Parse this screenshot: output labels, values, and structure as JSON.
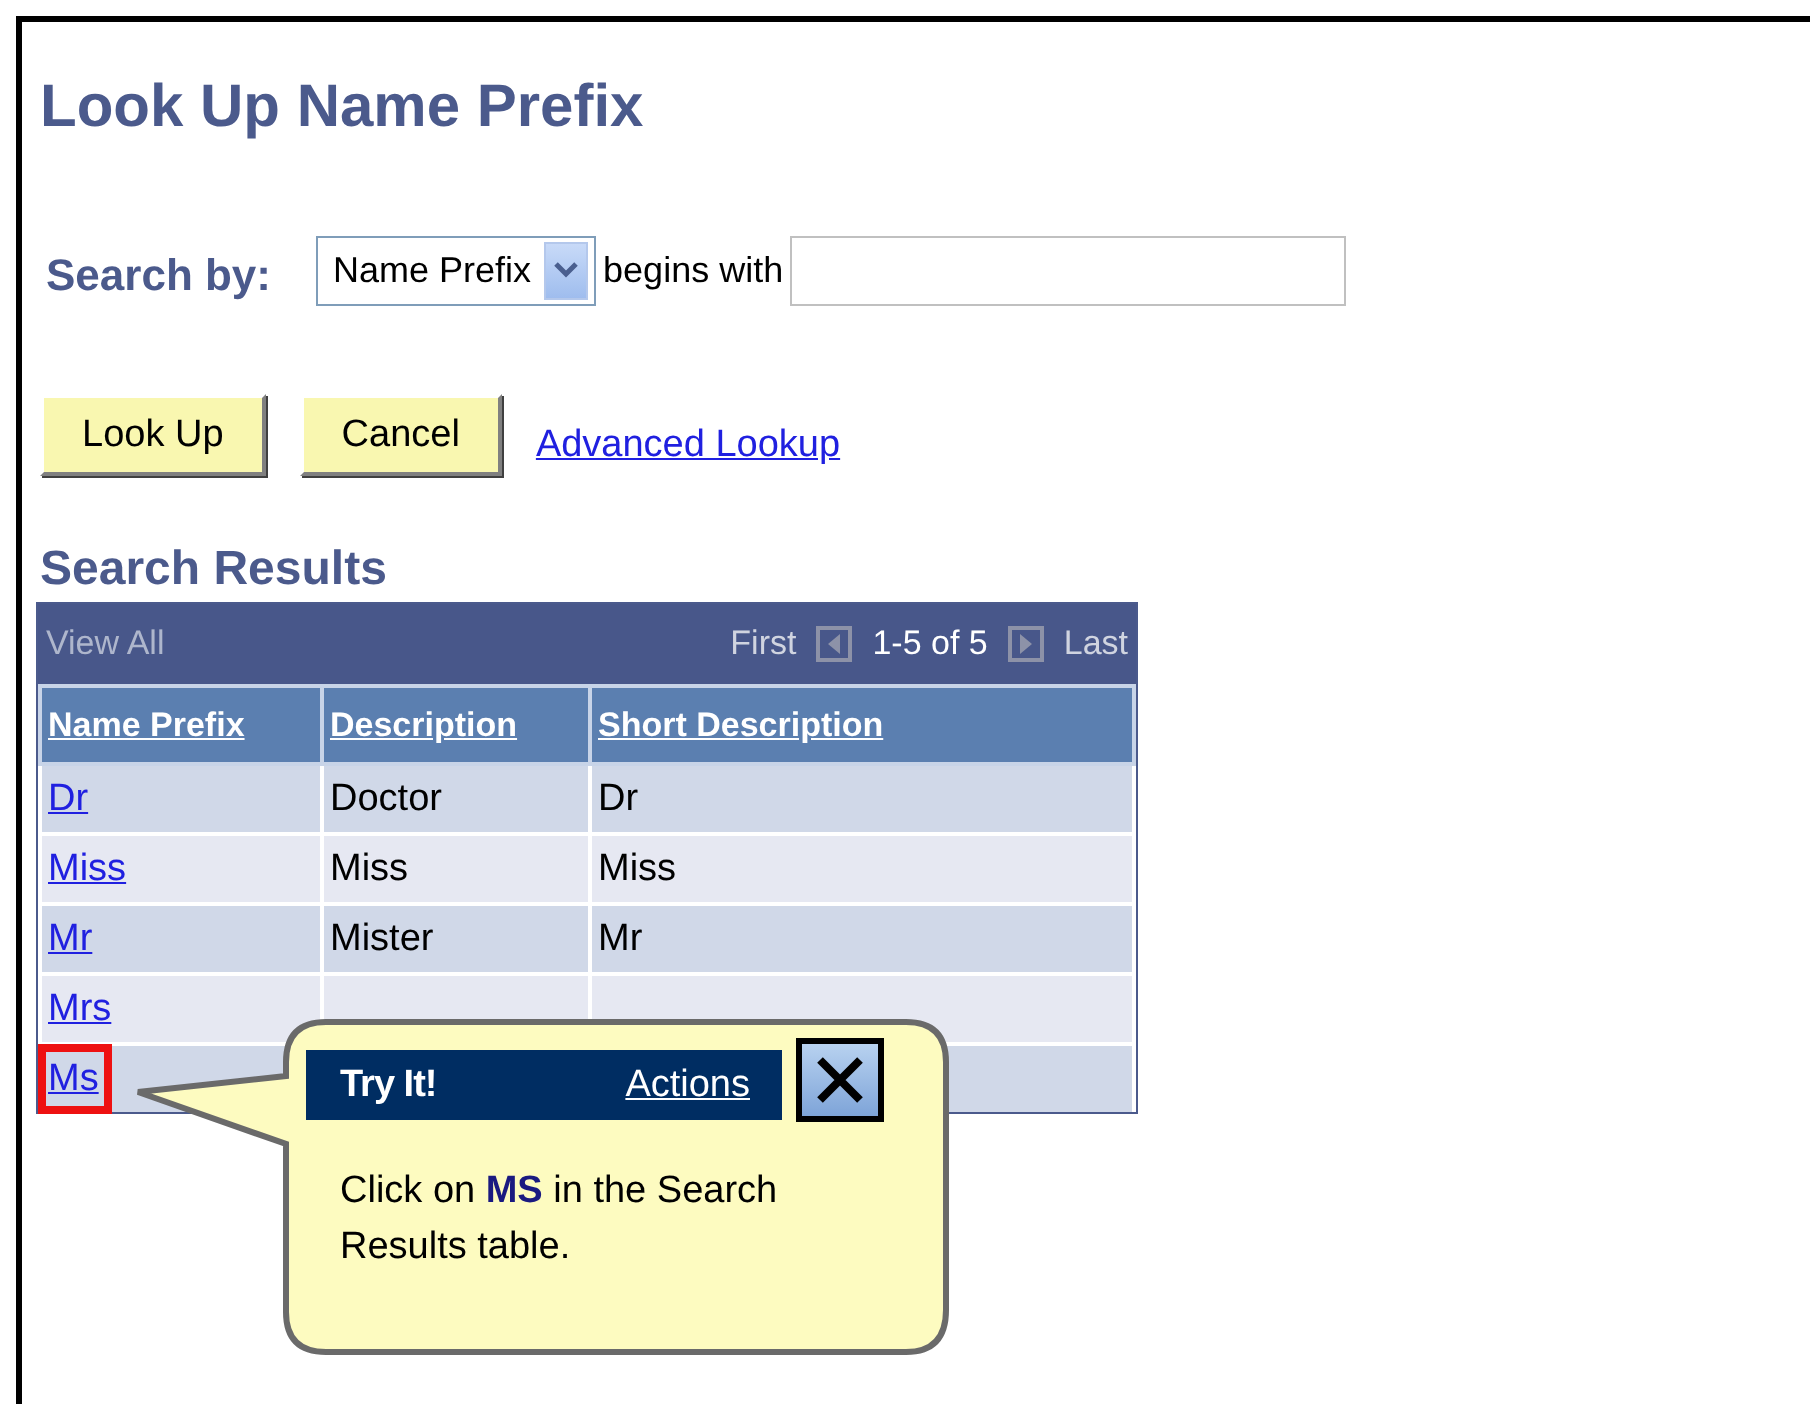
{
  "title": "Look Up Name Prefix",
  "search": {
    "label": "Search by:",
    "field": "Name Prefix",
    "operator": "begins with"
  },
  "buttons": [
    "Look Up",
    "Cancel"
  ],
  "link": "Advanced Lookup",
  "results": {
    "title": "Search Results",
    "view_all": "View All",
    "first": "First",
    "range": "1-5 of 5",
    "last": "Last",
    "columns": [
      "Name Prefix",
      "Description",
      "Short Description"
    ],
    "rows": [
      {
        "name_prefix": "Dr",
        "description": "Doctor",
        "short_description": "Dr",
        "highlighted": false
      },
      {
        "name_prefix": "Miss",
        "description": "Miss",
        "short_description": "Miss",
        "highlighted": false
      },
      {
        "name_prefix": "Mr",
        "description": "Mister",
        "short_description": "Mr",
        "highlighted": false
      },
      {
        "name_prefix": "Mrs",
        "highlighted": false
      },
      {
        "name_prefix": "Ms",
        "highlighted": true
      }
    ]
  },
  "callout": {
    "title": "Try It!",
    "actions": "Actions",
    "message": "Click on **MS** in the Search Results table."
  }
}
